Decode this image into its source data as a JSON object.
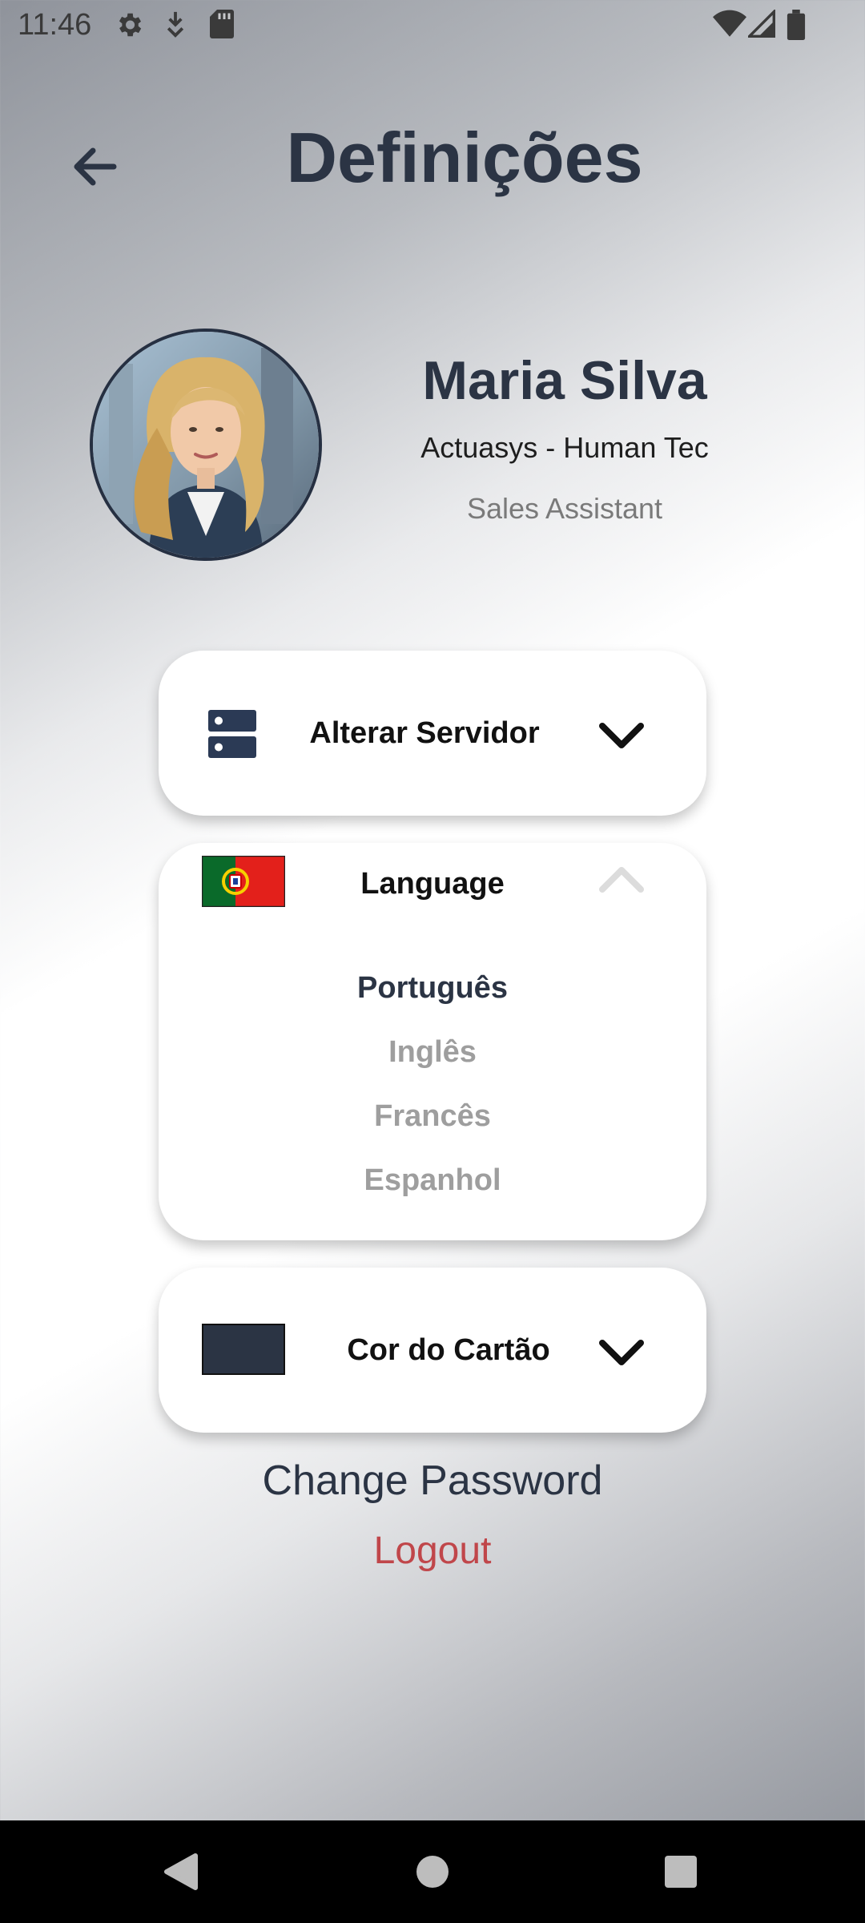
{
  "status_bar": {
    "time": "11:46",
    "left_icons": [
      "gear-icon",
      "download-icon",
      "sd-card-icon"
    ],
    "right_icons": [
      "wifi-icon",
      "signal-icon",
      "battery-icon"
    ]
  },
  "header": {
    "title": "Definições",
    "back_icon": "arrow-left-icon"
  },
  "profile": {
    "name": "Maria Silva",
    "company": "Actuasys - Human Tec",
    "role": "Sales Assistant"
  },
  "server_card": {
    "label": "Alterar Servidor",
    "icon": "server-icon",
    "expanded": false
  },
  "language_card": {
    "label": "Language",
    "flag": "portugal-flag-icon",
    "expanded": true,
    "options": [
      {
        "label": "Português",
        "selected": true
      },
      {
        "label": "Inglês",
        "selected": false
      },
      {
        "label": "Francês",
        "selected": false
      },
      {
        "label": "Espanhol",
        "selected": false
      }
    ]
  },
  "card_color_card": {
    "label": "Cor do Cartão",
    "swatch_color": "#2b3444",
    "expanded": false
  },
  "actions": {
    "change_password": "Change Password",
    "logout": "Logout"
  },
  "colors": {
    "primary_text": "#2b3444",
    "logout": "#c0464a",
    "muted": "#9e9e9e"
  }
}
